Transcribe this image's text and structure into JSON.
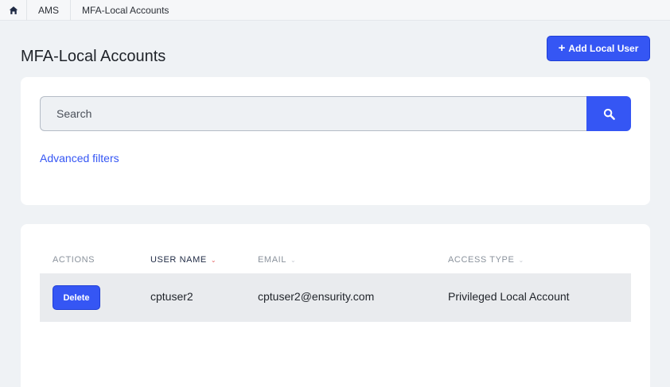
{
  "breadcrumb": {
    "home_icon": "home-icon",
    "items": [
      "AMS",
      "MFA-Local Accounts"
    ]
  },
  "page": {
    "title": "MFA-Local Accounts",
    "add_button_label": "Add Local User"
  },
  "filters": {
    "search_placeholder": "Search",
    "search_value": "",
    "search_icon": "search-icon",
    "advanced_filters_label": "Advanced filters"
  },
  "table": {
    "columns": [
      "ACTIONS",
      "USER NAME",
      "EMAIL",
      "ACCESS TYPE"
    ],
    "sorted_column": "USER NAME",
    "rows": [
      {
        "action_label": "Delete",
        "user_name": "cptuser2",
        "email": "cptuser2@ensurity.com",
        "access_type": "Privileged Local Account"
      }
    ]
  },
  "colors": {
    "accent": "#3556f4",
    "page_background": "#eff2f5",
    "row_background": "#e9ebee",
    "sort_indicator": "#e25b5b"
  }
}
